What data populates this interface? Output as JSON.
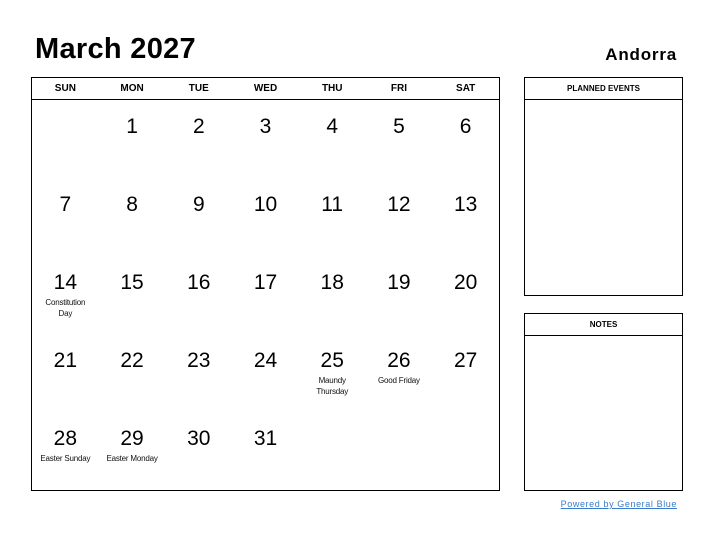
{
  "header": {
    "title": "March 2027",
    "country": "Andorra"
  },
  "calendar": {
    "weekdays": [
      "SUN",
      "MON",
      "TUE",
      "WED",
      "THU",
      "FRI",
      "SAT"
    ],
    "weeks": [
      [
        {
          "day": ""
        },
        {
          "day": "1"
        },
        {
          "day": "2"
        },
        {
          "day": "3"
        },
        {
          "day": "4"
        },
        {
          "day": "5"
        },
        {
          "day": "6"
        }
      ],
      [
        {
          "day": "7"
        },
        {
          "day": "8"
        },
        {
          "day": "9"
        },
        {
          "day": "10"
        },
        {
          "day": "11"
        },
        {
          "day": "12"
        },
        {
          "day": "13"
        }
      ],
      [
        {
          "day": "14",
          "holiday": "Constitution Day"
        },
        {
          "day": "15"
        },
        {
          "day": "16"
        },
        {
          "day": "17"
        },
        {
          "day": "18"
        },
        {
          "day": "19"
        },
        {
          "day": "20"
        }
      ],
      [
        {
          "day": "21"
        },
        {
          "day": "22"
        },
        {
          "day": "23"
        },
        {
          "day": "24"
        },
        {
          "day": "25",
          "holiday": "Maundy Thursday"
        },
        {
          "day": "26",
          "holiday": "Good Friday"
        },
        {
          "day": "27"
        }
      ],
      [
        {
          "day": "28",
          "holiday": "Easter Sunday"
        },
        {
          "day": "29",
          "holiday": "Easter Monday"
        },
        {
          "day": "30"
        },
        {
          "day": "31"
        },
        {
          "day": ""
        },
        {
          "day": ""
        },
        {
          "day": ""
        }
      ]
    ]
  },
  "panels": {
    "planned_events": "PLANNED EVENTS",
    "notes": "NOTES"
  },
  "footer": {
    "link": "Powered by General Blue",
    "color": "#3a7bc8"
  }
}
